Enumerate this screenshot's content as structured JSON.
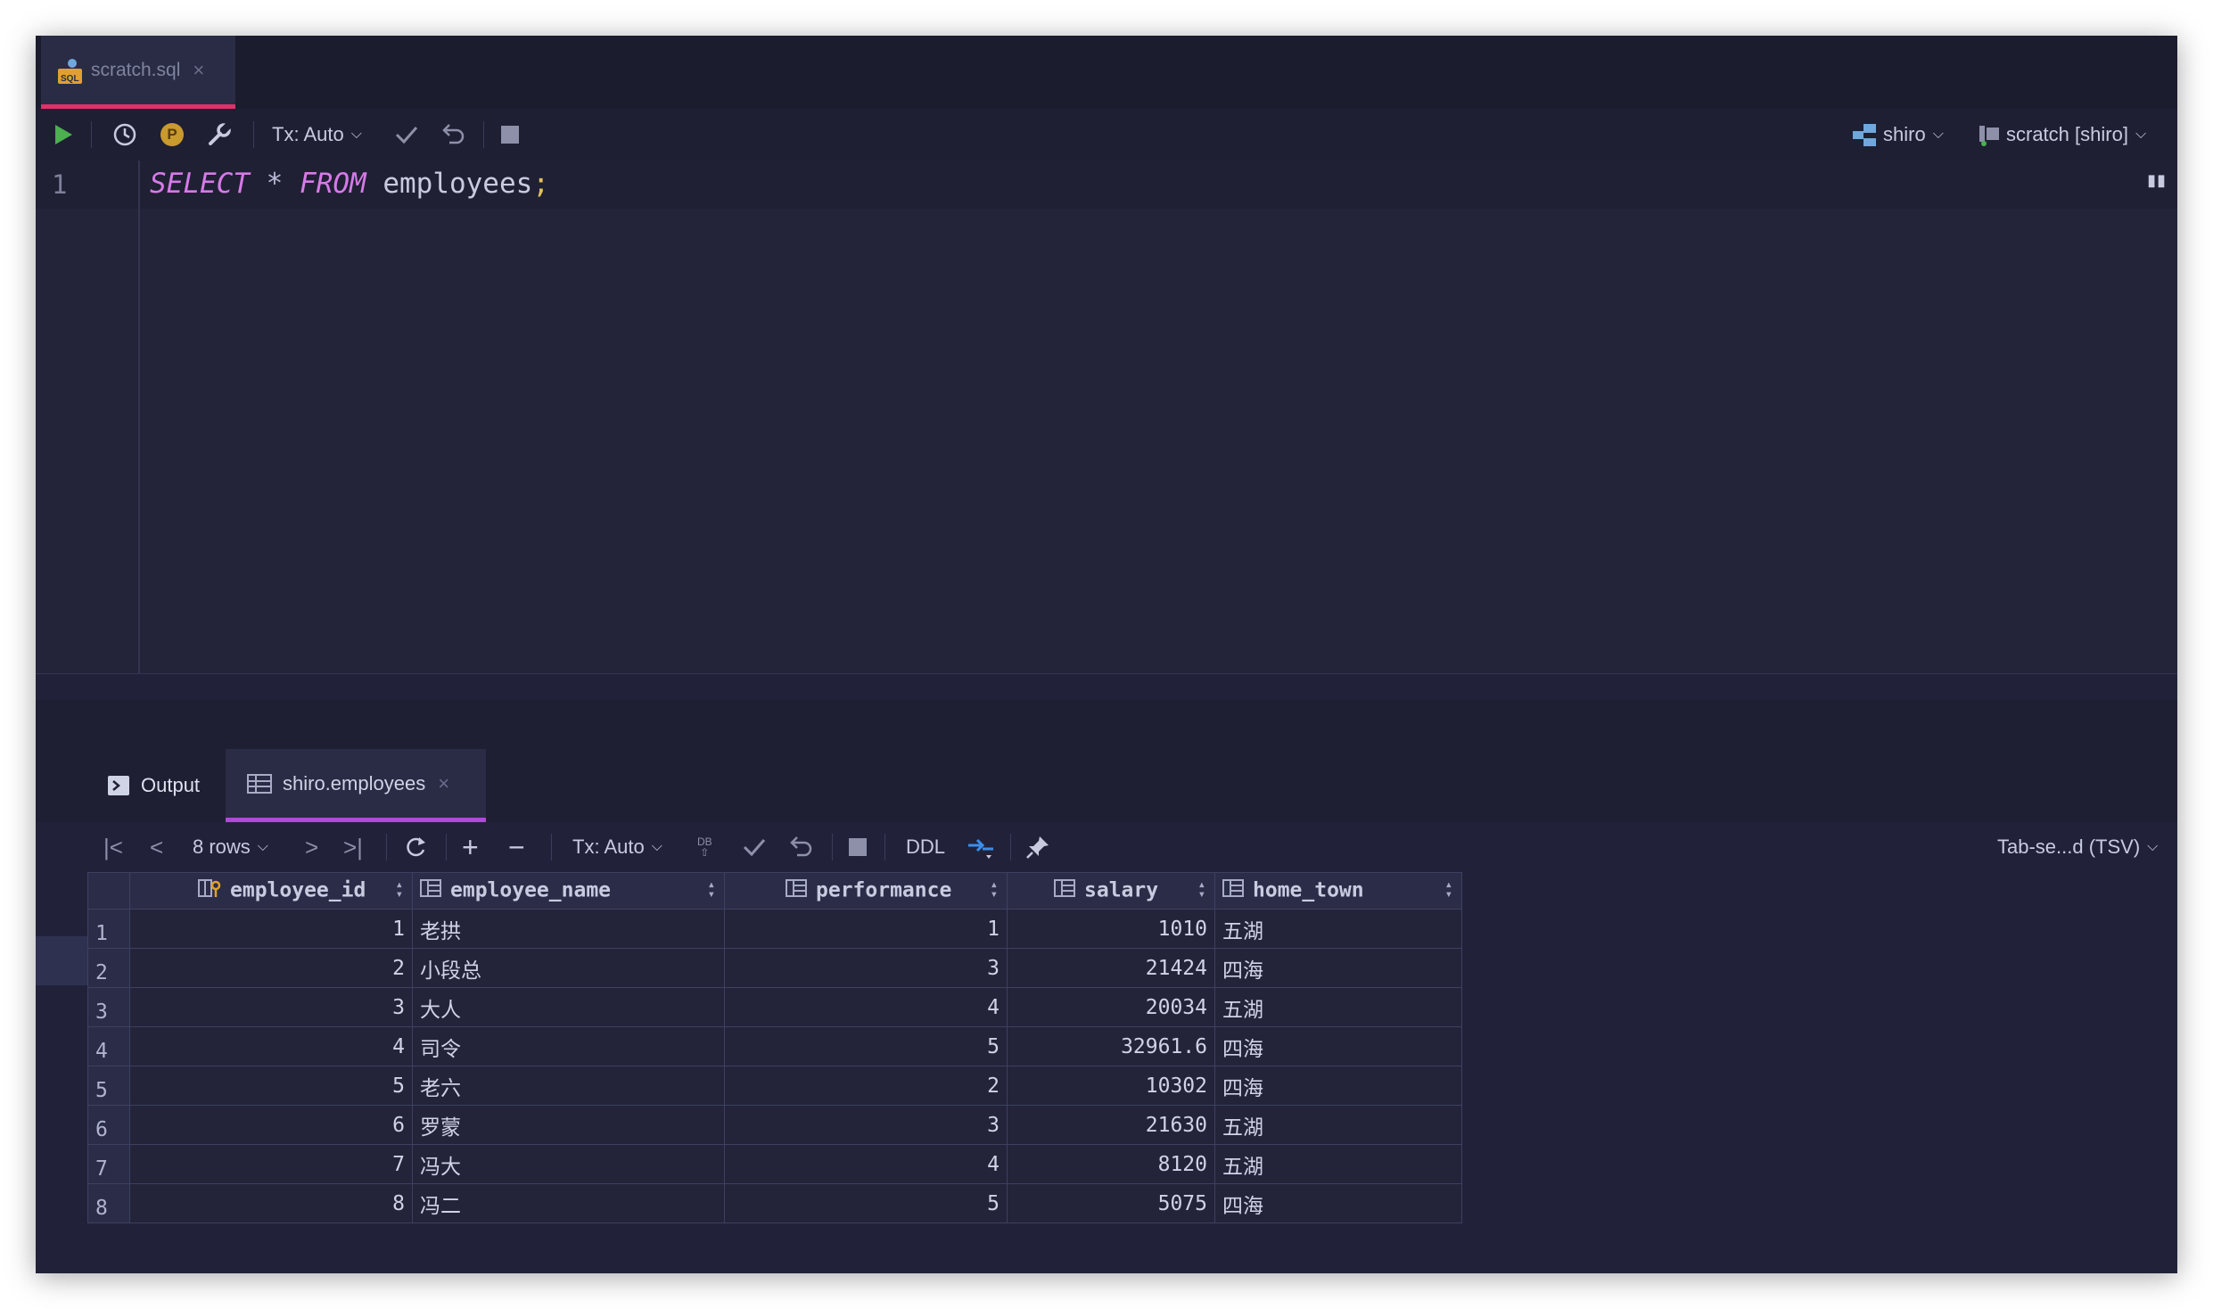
{
  "editor_tab": {
    "label": "scratch.sql",
    "close": "×"
  },
  "toolbar": {
    "tx_label": "Tx: Auto",
    "p_badge": "P",
    "schema_label": "shiro",
    "console_label": "scratch [shiro]"
  },
  "editor": {
    "line_number": "1",
    "tokens": {
      "select": "SELECT",
      "star": "*",
      "from": "FROM",
      "table": "employees",
      "semi": ";"
    }
  },
  "results_tabs": {
    "output_label": "Output",
    "table_tab_label": "shiro.employees",
    "close": "×"
  },
  "results_toolbar": {
    "rows_label": "8 rows",
    "tx_label": "Tx: Auto",
    "db_label": "DB",
    "ddl_label": "DDL",
    "export_label": "Tab-se...d (TSV)"
  },
  "grid": {
    "columns": [
      "employee_id",
      "employee_name",
      "performance",
      "salary",
      "home_town"
    ],
    "rows": [
      [
        "1",
        "1",
        "老拱",
        "1",
        "1010",
        "五湖"
      ],
      [
        "2",
        "2",
        "小段总",
        "3",
        "21424",
        "四海"
      ],
      [
        "3",
        "3",
        "大人",
        "4",
        "20034",
        "五湖"
      ],
      [
        "4",
        "4",
        "司令",
        "5",
        "32961.6",
        "四海"
      ],
      [
        "5",
        "5",
        "老六",
        "2",
        "10302",
        "四海"
      ],
      [
        "6",
        "6",
        "罗蒙",
        "3",
        "21630",
        "五湖"
      ],
      [
        "7",
        "7",
        "冯大",
        "4",
        "8120",
        "五湖"
      ],
      [
        "8",
        "8",
        "冯二",
        "5",
        "5075",
        "四海"
      ]
    ]
  },
  "colors": {
    "accent_tab": "#e0316b",
    "results_tab": "#b04ad8",
    "keyword": "#d67ae8",
    "run_green": "#4caf50"
  }
}
